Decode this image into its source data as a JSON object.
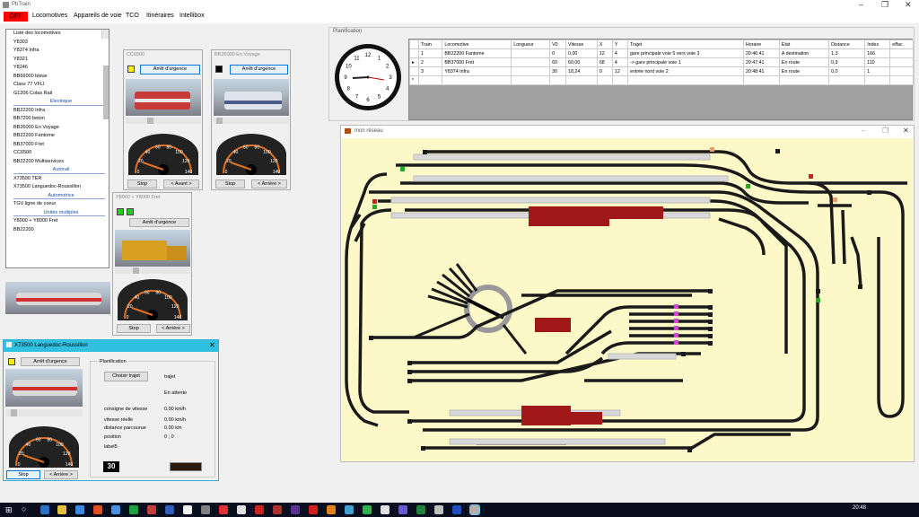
{
  "app": {
    "title": "PbTrain",
    "off_label": "OFF"
  },
  "menu": [
    "Locomotives",
    "Appareils de voie",
    "TCO",
    "Itinéraires",
    "Intellibox"
  ],
  "loco_list": {
    "items": [
      {
        "t": "Liste des locomotives",
        "c": false
      },
      {
        "t": "Y8303",
        "c": false
      },
      {
        "t": "Y8374 Infra",
        "c": false
      },
      {
        "t": "Y8321",
        "c": false
      },
      {
        "t": "Y8246",
        "c": false
      },
      {
        "t": "BB66000 bleue",
        "c": false
      },
      {
        "t": "Class 77 VFLI",
        "c": false
      },
      {
        "t": "G1206 Colas Rail",
        "c": false
      },
      {
        "t": "Electrique",
        "c": true
      },
      {
        "t": "BB22200 Infra",
        "c": false
      },
      {
        "t": "BB7200 beton",
        "c": false
      },
      {
        "t": "BB26000 En Voyage",
        "c": false
      },
      {
        "t": "BB22200 Fantome",
        "c": false
      },
      {
        "t": "BB37000 Fret",
        "c": false
      },
      {
        "t": "CC6500",
        "c": false
      },
      {
        "t": "BB22200 Multiservices",
        "c": false
      },
      {
        "t": "Autorail",
        "c": true
      },
      {
        "t": "X73500 TER",
        "c": false
      },
      {
        "t": "X73500 Languedoc-Roussillon",
        "c": false
      },
      {
        "t": "Automotrice",
        "c": true
      },
      {
        "t": "TGV ligne de coeur",
        "c": false
      },
      {
        "t": "Unités multiples",
        "c": true
      },
      {
        "t": "Y8000 + Y8000 Fret",
        "c": false
      },
      {
        "t": "BB22200",
        "c": false
      }
    ]
  },
  "cc6500": {
    "title": "CC6500",
    "urgence": "Arrêt d'urgence",
    "stop": "Stop",
    "dir": "< Avant >"
  },
  "bb26000": {
    "title": "BB26000 En Voyage",
    "urgence": "Arrêt d'urgence",
    "stop": "Stop",
    "dir": "< Arrière >"
  },
  "y8000": {
    "title": "Y8000 + Y8000 Fret",
    "urgence": "Arrêt d'urgence",
    "stop": "Stop",
    "dir": "< Arrière >"
  },
  "x73500": {
    "title": "X73500 Languedoc-Roussillon",
    "urgence": "Arrêt d'urgence",
    "planif": "Planification",
    "choisir": "Choisir trajet",
    "trajet": "trajet",
    "attente": "En attente",
    "consigne_l": "consigne de vitesse",
    "consigne_v": "0.00 km/h",
    "reelle_l": "vitesse réelle",
    "reelle_v": "0.00 km/h",
    "distance_l": "distance parcourue",
    "distance_v": "0.00 km",
    "position_l": "position",
    "position_v": "0 ; 0",
    "label5": "label5",
    "addr": "30",
    "stop": "Stop",
    "dir": "< Arrière >"
  },
  "gauge_ticks": [
    "0",
    "20",
    "40",
    "60",
    "80",
    "100",
    "120",
    "140"
  ],
  "planif": {
    "title": "Planification",
    "headers": [
      "Train",
      "Locomotive",
      "Longueur",
      "V0",
      "Vitesse",
      "X",
      "Y",
      "Trajet",
      "Horaire",
      "Etat",
      "Distance",
      "Index",
      "effac"
    ],
    "rows": [
      [
        "1",
        "BB22200 Fantome",
        "",
        "0",
        "0,00",
        "12",
        "4",
        "gare principale voie 5 vers voie 3",
        "20:46:41",
        "A destination",
        "1,3",
        "166",
        ""
      ],
      [
        "2",
        "BB37000 Fret",
        "",
        "60",
        "60,00",
        "68",
        "4",
        "-> gare principale voie 1",
        "20:47:41",
        "En route",
        "0,9",
        "110",
        ""
      ],
      [
        "3",
        "Y8374 Infra",
        "",
        "30",
        "18,24",
        "0",
        "12",
        "entrée nord voie 2",
        "20:48:41",
        "En route",
        "0,0",
        "1",
        ""
      ]
    ],
    "new_row_marker": "*",
    "current_row_marker": "▸"
  },
  "reseau": {
    "title": "mon réseau"
  },
  "clock": {
    "numbers": [
      "12",
      "1",
      "2",
      "3",
      "4",
      "5",
      "6",
      "7",
      "8",
      "9",
      "10",
      "11"
    ]
  },
  "taskbar": {
    "time": "20:48"
  },
  "colors": {
    "off": "#ff0000",
    "platform": "#a01818",
    "track": "#1a1a1a",
    "canvas": "#fdf8c8",
    "accent": "#0078d7"
  }
}
